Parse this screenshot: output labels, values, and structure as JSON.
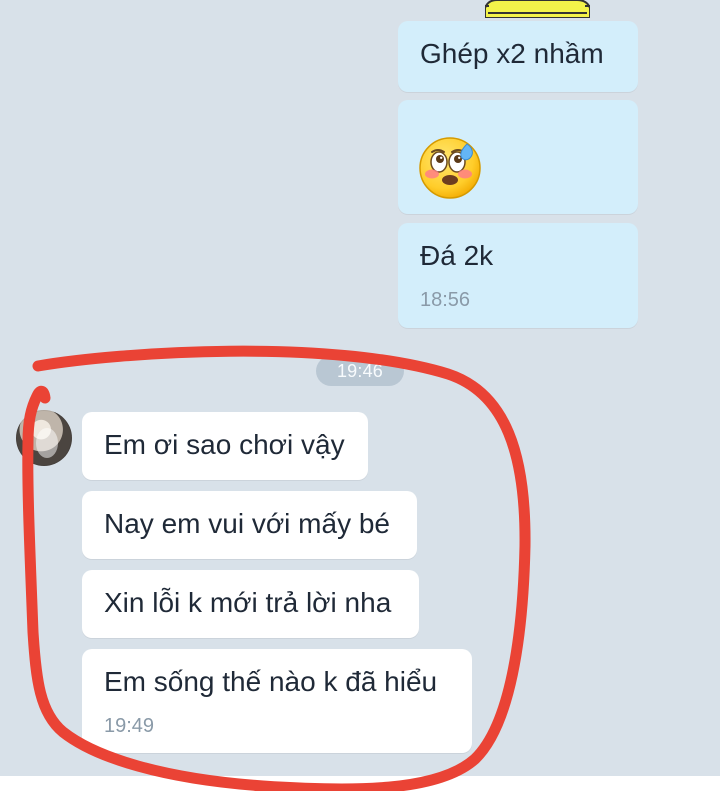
{
  "conversation": {
    "outgoing": {
      "message_1": "Ghép x2 nhầm",
      "message_3": "Đá 2k",
      "time": "18:56"
    },
    "divider": {
      "partial_time": "19:46"
    },
    "incoming": {
      "message_1": "Em ơi sao chơi vậy",
      "message_2": "Nay em vui với mấy bé",
      "message_3": "Xin lỗi k mới trả lời nha",
      "message_4": "Em sống thế nào k đã hiểu",
      "time": "19:49"
    }
  },
  "icons": {
    "emoji": "face-with-pleading-eyes-and-sweat-icon",
    "avatar": "avatar"
  },
  "colors": {
    "background": "#d8e1e9",
    "outgoing_bubble": "#d3eefb",
    "incoming_bubble": "#ffffff",
    "annotation": "#ea4335"
  }
}
